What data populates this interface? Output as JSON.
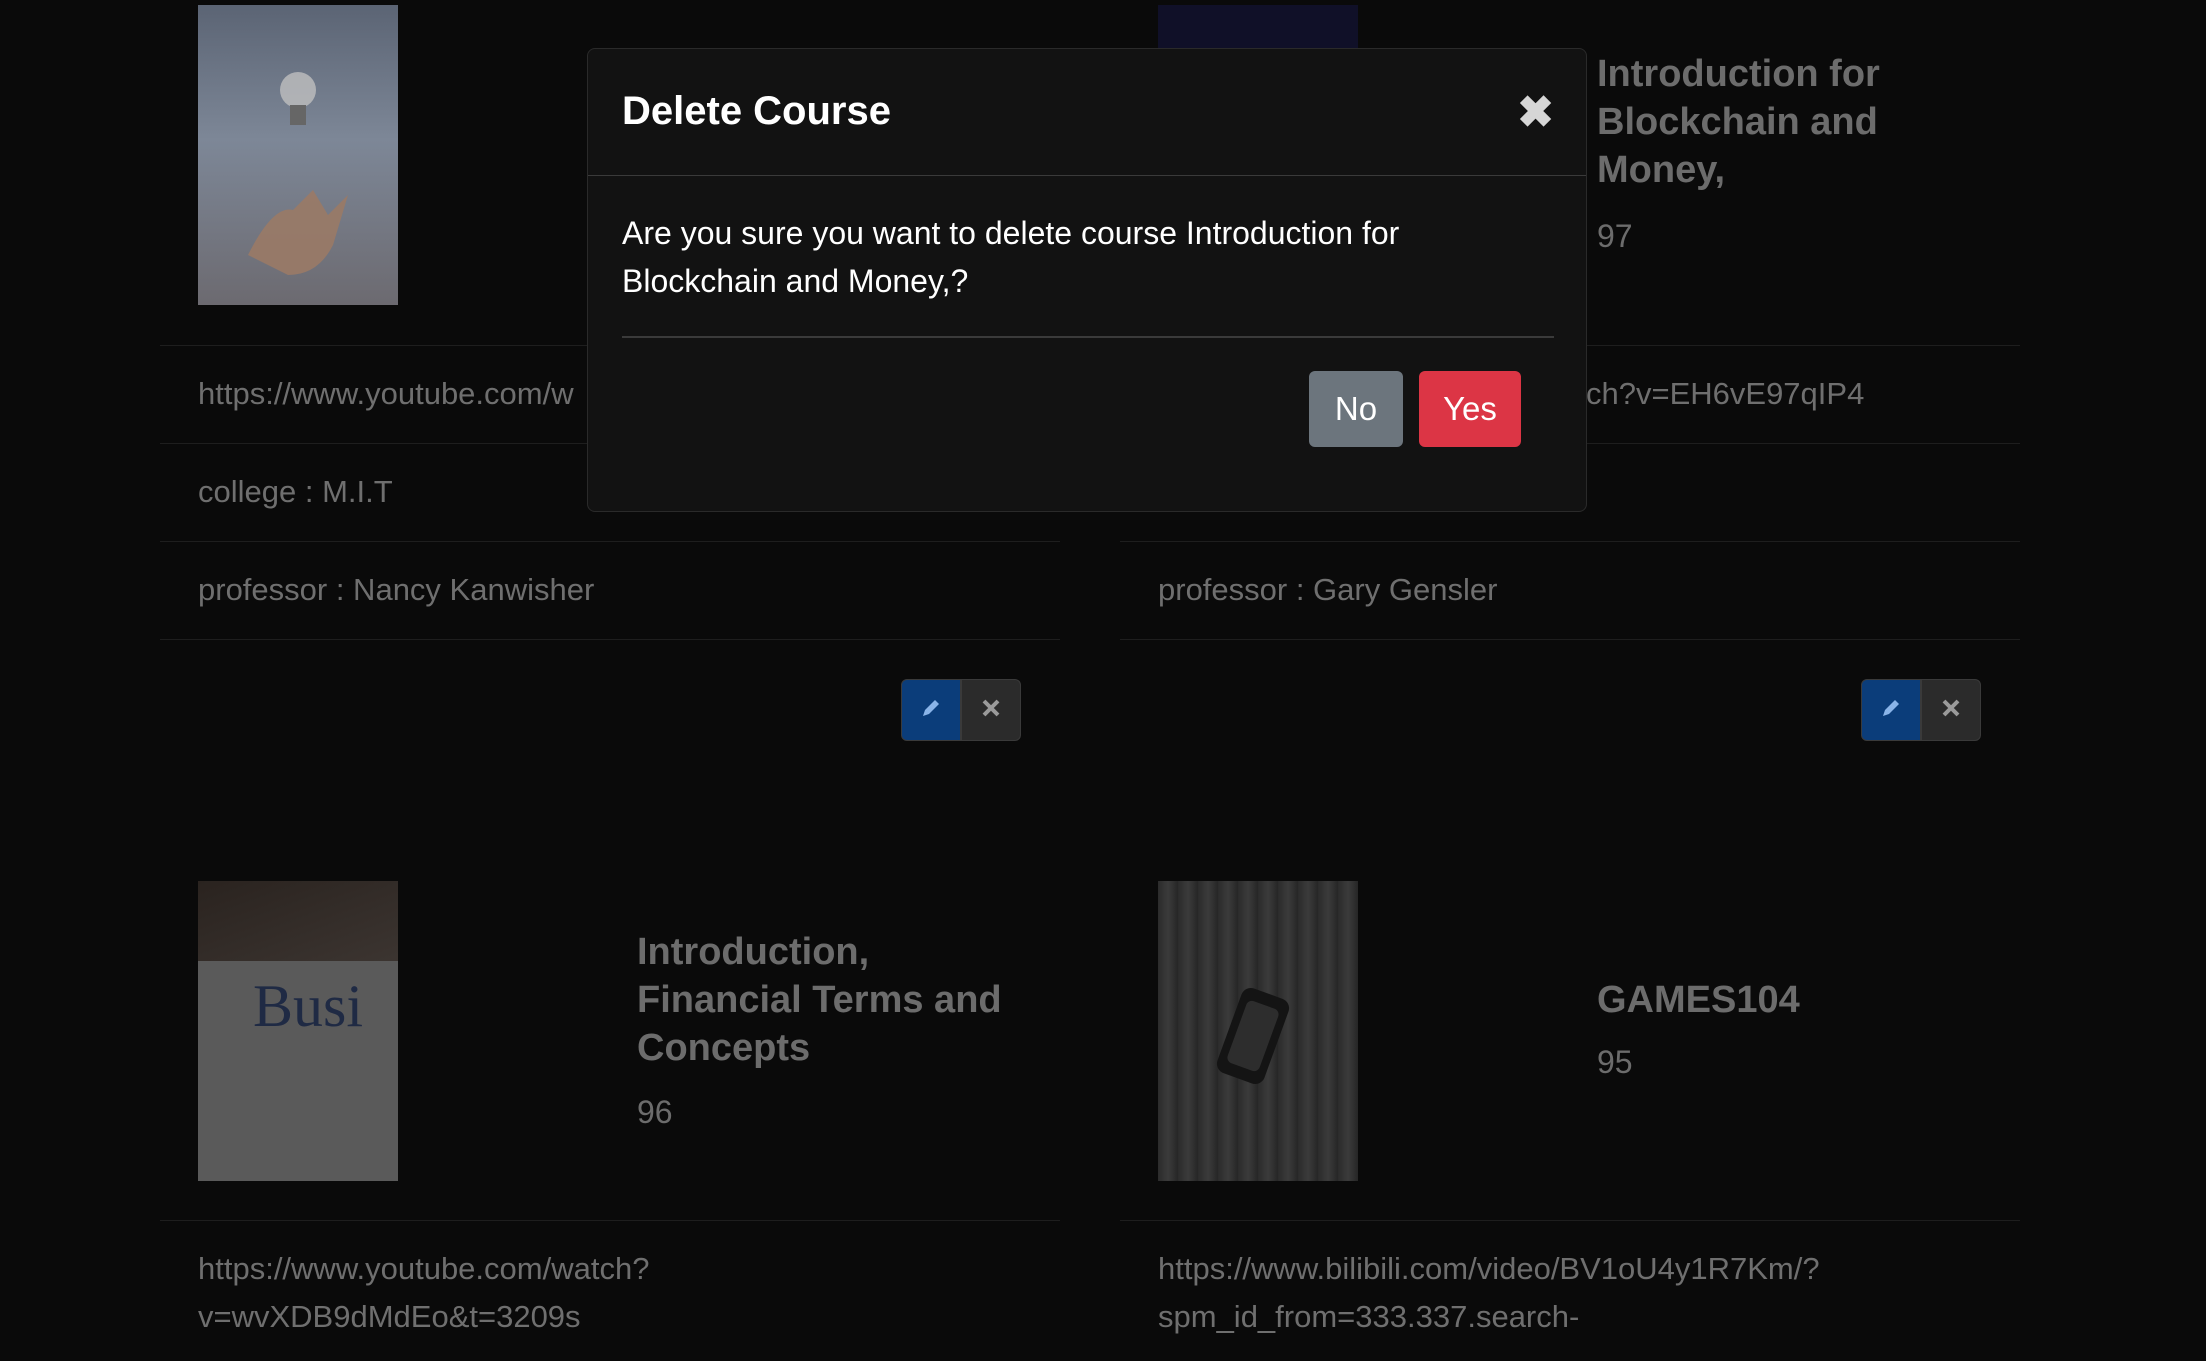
{
  "cards": [
    {
      "title": "",
      "score": "",
      "link": "https://www.youtube.com/w",
      "college": "college : M.I.T",
      "professor": "professor : Nancy Kanwisher"
    },
    {
      "title": "Introduction for Blockchain and Money,",
      "score": "97",
      "link": "ch?v=EH6vE97qIP4",
      "professor": "professor : Gary Gensler"
    },
    {
      "title": "Introduction, Financial Terms and Concepts",
      "score": "96",
      "link_line1": "https://www.youtube.com/watch?",
      "link_line2": "v=wvXDB9dMdEo&t=3209s"
    },
    {
      "title": "GAMES104",
      "score": "95",
      "link_line1": "https://www.bilibili.com/video/BV1oU4y1R7Km/?",
      "link_line2": "spm_id_from=333.337.search-"
    }
  ],
  "modal": {
    "title": "Delete Course",
    "close": "✖",
    "message": "Are you sure you want to delete course Introduction for Blockchain and Money,?",
    "no_label": "No",
    "yes_label": "Yes"
  },
  "icons": {
    "edit": "pencil-icon",
    "delete": "x-icon"
  },
  "colors": {
    "edit_button": "#0b3d7a",
    "yes_button": "#dc3545",
    "no_button": "#6c757d"
  }
}
